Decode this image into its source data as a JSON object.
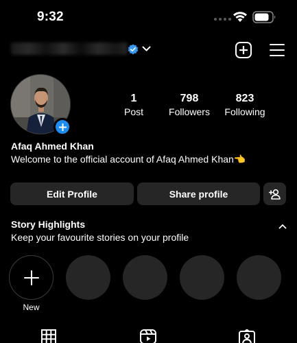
{
  "status_bar": {
    "time": "9:32"
  },
  "header": {
    "username": "",
    "verified": true
  },
  "profile": {
    "stats": [
      {
        "value": "1",
        "label": "Post"
      },
      {
        "value": "798",
        "label": "Followers"
      },
      {
        "value": "823",
        "label": "Following"
      }
    ],
    "display_name": "Afaq Ahmed Khan",
    "bio": "Welcome to the official account of Afaq Ahmed Khan",
    "bio_emoji": "👈"
  },
  "actions": {
    "edit_label": "Edit Profile",
    "share_label": "Share profile"
  },
  "highlights": {
    "title": "Story Highlights",
    "subtitle": "Keep your favourite stories on your profile",
    "new_label": "New"
  },
  "tabs": [
    {
      "icon": "grid-icon"
    },
    {
      "icon": "reels-icon"
    },
    {
      "icon": "tagged-icon"
    }
  ],
  "colors": {
    "accent": "#1d8cf0",
    "button_bg": "#262626",
    "background": "#000000"
  }
}
